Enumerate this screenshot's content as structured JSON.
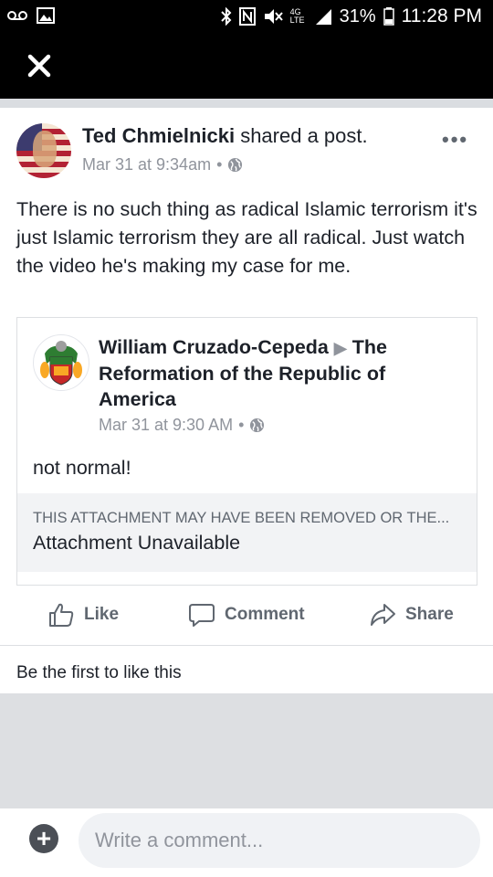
{
  "status_bar": {
    "battery": "31%",
    "time": "11:28 PM",
    "network": "4G LTE",
    "icons": [
      "voicemail-icon",
      "image-icon",
      "bluetooth-icon",
      "nfc-icon",
      "mute-icon",
      "signal-icon",
      "battery-icon"
    ]
  },
  "nav": {
    "close_label": "✕"
  },
  "post": {
    "author": "Ted Chmielnicki",
    "action": " shared a post.",
    "timestamp": "Mar 31 at 9:34am",
    "dot": "•",
    "more": "•••",
    "text": "There is no such thing as radical Islamic terrorism it's just Islamic terrorism they are all radical. Just watch the video he's making my case for me."
  },
  "shared": {
    "author": "William Cruzado-Cepeda",
    "arrow": "▶",
    "group": "The Reformation of the Republic of America",
    "timestamp": "Mar 31 at 9:30 AM",
    "dot": "•",
    "text": "not normal!",
    "attachment_warning": "THIS ATTACHMENT MAY HAVE BEEN REMOVED OR THE...",
    "attachment_title": "Attachment Unavailable"
  },
  "actions": {
    "like": "Like",
    "comment": "Comment",
    "share": "Share"
  },
  "likes_text": "Be the first to like this",
  "composer": {
    "placeholder": "Write a comment...",
    "add_label": "+"
  },
  "colors": {
    "text": "#1d2129",
    "muted": "#90949c",
    "action": "#606770",
    "divider": "#dddfe2"
  }
}
